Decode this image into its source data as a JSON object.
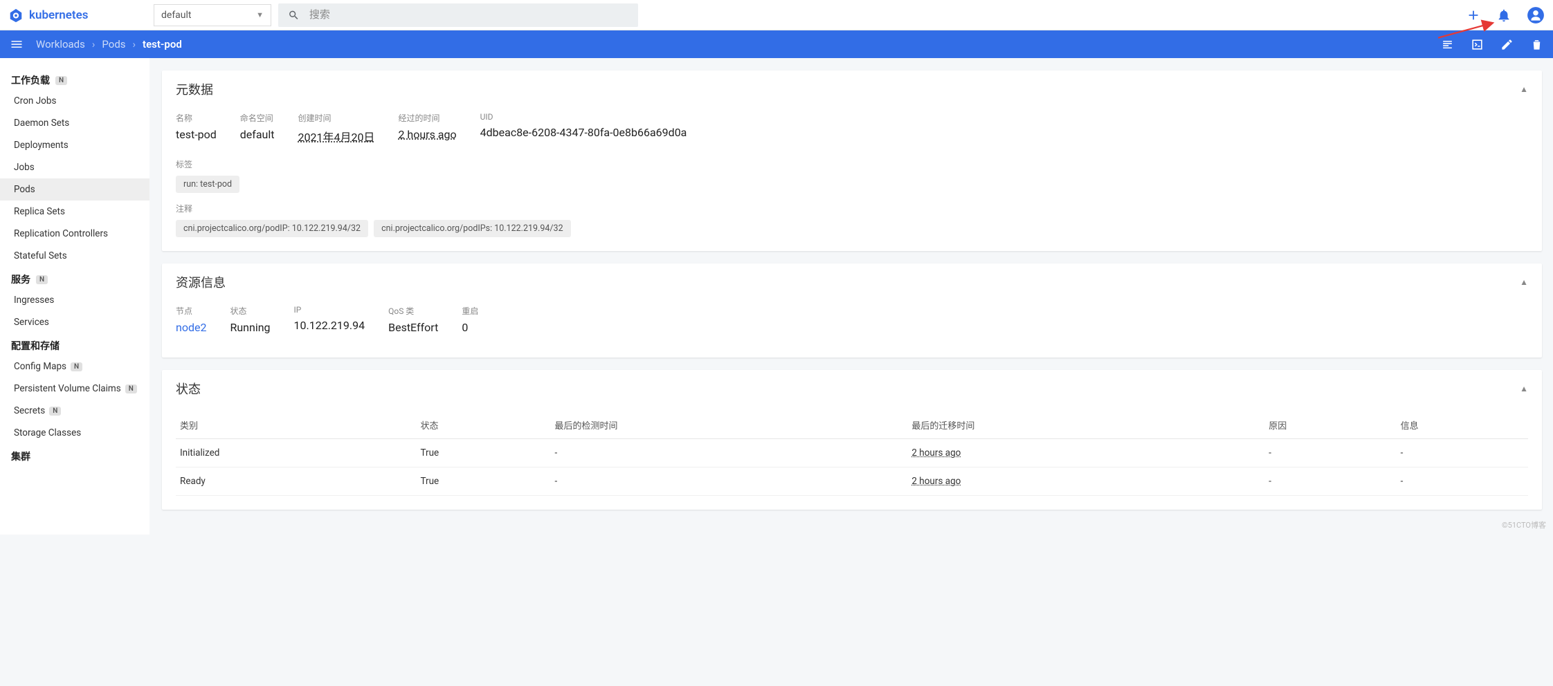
{
  "header": {
    "brand": "kubernetes",
    "namespace": "default",
    "searchPlaceholder": "搜索"
  },
  "breadcrumb": {
    "root": "Workloads",
    "section": "Pods",
    "current": "test-pod"
  },
  "sidebar": {
    "sections": [
      {
        "title": "工作负载",
        "badge": "N",
        "items": [
          {
            "label": "Cron Jobs"
          },
          {
            "label": "Daemon Sets"
          },
          {
            "label": "Deployments"
          },
          {
            "label": "Jobs"
          },
          {
            "label": "Pods",
            "active": true
          },
          {
            "label": "Replica Sets"
          },
          {
            "label": "Replication Controllers"
          },
          {
            "label": "Stateful Sets"
          }
        ]
      },
      {
        "title": "服务",
        "badge": "N",
        "items": [
          {
            "label": "Ingresses"
          },
          {
            "label": "Services"
          }
        ]
      },
      {
        "title": "配置和存储",
        "items": [
          {
            "label": "Config Maps",
            "badge": "N"
          },
          {
            "label": "Persistent Volume Claims",
            "badge": "N"
          },
          {
            "label": "Secrets",
            "badge": "N"
          },
          {
            "label": "Storage Classes"
          }
        ]
      },
      {
        "title": "集群",
        "items": []
      }
    ]
  },
  "metadata": {
    "cardTitle": "元数据",
    "name": {
      "label": "名称",
      "value": "test-pod"
    },
    "namespace": {
      "label": "命名空间",
      "value": "default"
    },
    "created": {
      "label": "创建时间",
      "value": "2021年4月20日"
    },
    "elapsed": {
      "label": "经过的时间",
      "value": "2 hours ago"
    },
    "uid": {
      "label": "UID",
      "value": "4dbeac8e-6208-4347-80fa-0e8b66a69d0a"
    },
    "labels": {
      "header": "标签",
      "chips": [
        "run: test-pod"
      ]
    },
    "annotations": {
      "header": "注释",
      "chips": [
        "cni.projectcalico.org/podIP: 10.122.219.94/32",
        "cni.projectcalico.org/podIPs: 10.122.219.94/32"
      ]
    }
  },
  "resource": {
    "cardTitle": "资源信息",
    "node": {
      "label": "节点",
      "value": "node2"
    },
    "status": {
      "label": "状态",
      "value": "Running"
    },
    "ip": {
      "label": "IP",
      "value": "10.122.219.94"
    },
    "qos": {
      "label": "QoS 类",
      "value": "BestEffort"
    },
    "restart": {
      "label": "重启",
      "value": "0"
    }
  },
  "status": {
    "cardTitle": "状态",
    "columns": [
      "类别",
      "状态",
      "最后的检测时间",
      "最后的迁移时间",
      "原因",
      "信息"
    ],
    "rows": [
      {
        "c0": "Initialized",
        "c1": "True",
        "c2": "-",
        "c3": "2 hours ago",
        "c4": "-",
        "c5": "-"
      },
      {
        "c0": "Ready",
        "c1": "True",
        "c2": "-",
        "c3": "2 hours ago",
        "c4": "-",
        "c5": "-"
      }
    ]
  },
  "watermark": "©51CTO博客"
}
